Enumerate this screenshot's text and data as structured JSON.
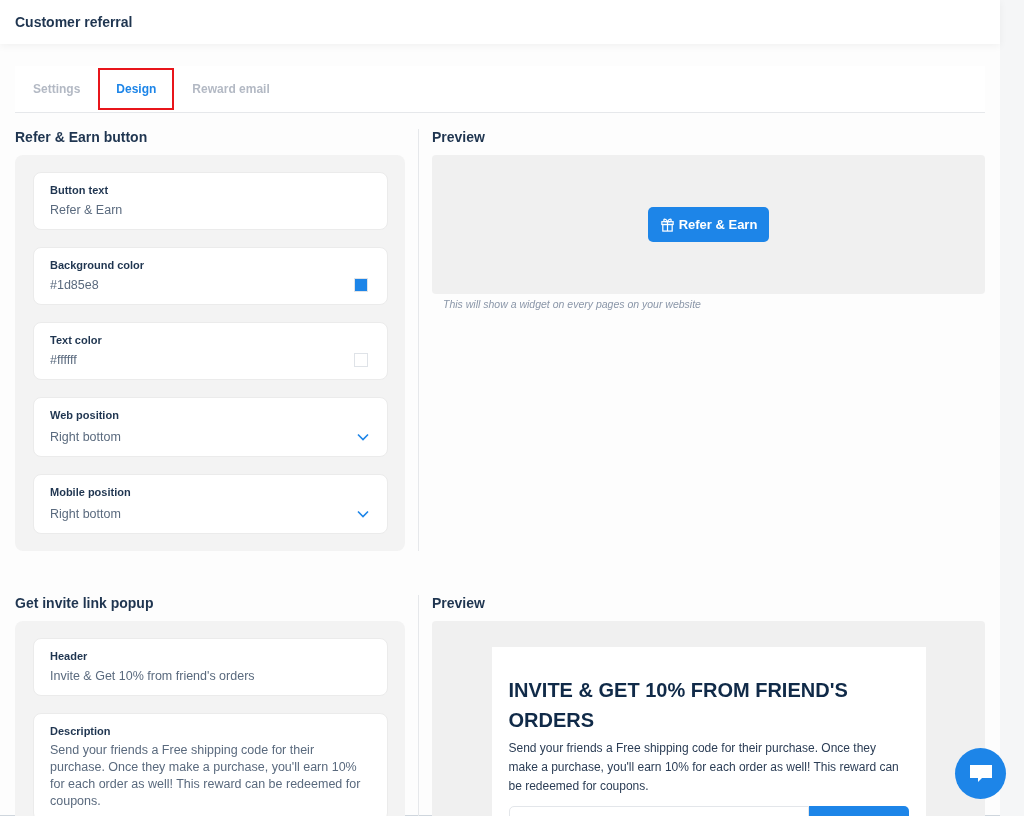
{
  "header": {
    "title": "Customer referral"
  },
  "tabs": [
    {
      "label": "Settings",
      "selected": false,
      "highlighted": false
    },
    {
      "label": "Design",
      "selected": true,
      "highlighted": true
    },
    {
      "label": "Reward email",
      "selected": false,
      "highlighted": false
    }
  ],
  "sections": [
    {
      "title": "Refer & Earn button",
      "fields": [
        {
          "kind": "text",
          "label": "Button text",
          "value": "Refer & Earn"
        },
        {
          "kind": "color",
          "label": "Background color",
          "value": "#1d85e8",
          "color": "#1d85e8"
        },
        {
          "kind": "color",
          "label": "Text color",
          "value": "#ffffff",
          "color": "#ffffff"
        },
        {
          "kind": "select",
          "label": "Web position",
          "value": "Right bottom"
        },
        {
          "kind": "select",
          "label": "Mobile position",
          "value": "Right bottom"
        }
      ],
      "preview": {
        "title": "Preview",
        "kind": "button",
        "button_label": "Refer & Earn",
        "caption": "This will show a widget on every pages on your website"
      }
    },
    {
      "title": "Get invite link popup",
      "fields": [
        {
          "kind": "text",
          "label": "Header",
          "value": "Invite & Get 10% from friend's orders"
        },
        {
          "kind": "textarea",
          "label": "Description",
          "value": "Send your friends a Free shipping code for their purchase. Once they make a purchase, you'll earn 10% for each order as well! This reward can be redeemed for coupons."
        }
      ],
      "preview": {
        "title": "Preview",
        "kind": "popup",
        "heading": "INVITE & GET 10% FROM FRIEND'S ORDERS",
        "text": "Send your friends a Free shipping code for their purchase. Once they make a purchase, you'll earn 10% for each order as well! This reward can be redeemed for coupons."
      }
    }
  ]
}
